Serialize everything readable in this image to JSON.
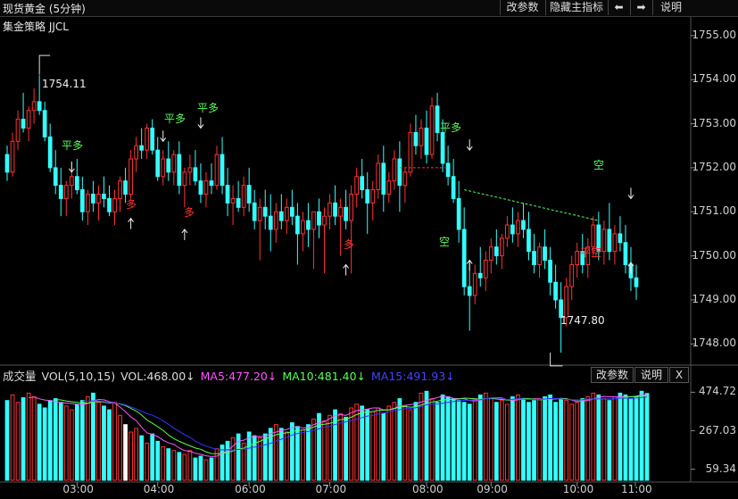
{
  "header": {
    "title": "现货黄金 (5分钟)",
    "btn_params": "改参数",
    "btn_hide": "隐藏主指标",
    "btn_left": "⬅",
    "btn_right": "➡",
    "btn_help": "说明"
  },
  "strategy_label": "集金策略 JJCL",
  "price_axis": [
    "1755.00",
    "1754.00",
    "1753.00",
    "1752.00",
    "1751.00",
    "1750.00",
    "1749.00",
    "1748.00"
  ],
  "annotations": {
    "high": "1754.11",
    "low": "1747.80"
  },
  "signals": {
    "flat_long": "平多",
    "long": "多",
    "short": "空",
    "flat_short": "平空"
  },
  "volume_legend": {
    "name": "成交量",
    "vol_params": "VOL(5,10,15)",
    "vol": "VOL:468.00↓",
    "ma5": "MA5:477.20↓",
    "ma10": "MA10:481.40↓",
    "ma15": "MA15:491.93↓",
    "btn_params": "改参数",
    "btn_help": "说明",
    "btn_close": "X"
  },
  "volume_axis": [
    "474.72",
    "267.03",
    "59.34"
  ],
  "time_axis": [
    "03:00",
    "04:00",
    "06:00",
    "07:00",
    "08:00",
    "09:00",
    "10:00",
    "11:00"
  ],
  "colors": {
    "up": "#ff3333",
    "down": "#33ffff",
    "ma5": "#ff55ff",
    "ma10": "#55ff55",
    "ma15": "#3333ff",
    "ma_white": "#ffffff"
  },
  "chart_data": {
    "type": "candlestick",
    "ylim": [
      1747.6,
      1755.2
    ],
    "candles": [
      [
        1752.3,
        1752.5,
        1751.7,
        1751.9
      ],
      [
        1751.9,
        1752.8,
        1751.8,
        1752.6
      ],
      [
        1752.6,
        1753.3,
        1752.4,
        1753.1
      ],
      [
        1753.1,
        1753.7,
        1752.8,
        1752.9
      ],
      [
        1752.9,
        1753.4,
        1752.6,
        1753.3
      ],
      [
        1753.3,
        1753.8,
        1753.0,
        1753.5
      ],
      [
        1753.5,
        1754.1,
        1753.2,
        1753.3
      ],
      [
        1753.3,
        1753.5,
        1752.6,
        1752.7
      ],
      [
        1752.7,
        1753.0,
        1751.9,
        1752.0
      ],
      [
        1752.0,
        1752.4,
        1751.4,
        1751.6
      ],
      [
        1751.6,
        1752.0,
        1750.9,
        1751.3
      ],
      [
        1751.3,
        1751.7,
        1750.9,
        1751.6
      ],
      [
        1751.6,
        1752.1,
        1751.3,
        1751.8
      ],
      [
        1751.8,
        1752.2,
        1751.4,
        1751.5
      ],
      [
        1751.5,
        1751.8,
        1750.8,
        1751.0
      ],
      [
        1751.0,
        1751.5,
        1750.7,
        1751.4
      ],
      [
        1751.4,
        1751.7,
        1751.0,
        1751.2
      ],
      [
        1751.2,
        1751.6,
        1750.8,
        1751.4
      ],
      [
        1751.4,
        1751.8,
        1751.1,
        1751.3
      ],
      [
        1751.3,
        1751.6,
        1750.9,
        1751.0
      ],
      [
        1751.0,
        1751.5,
        1750.7,
        1751.3
      ],
      [
        1751.3,
        1751.8,
        1751.0,
        1751.7
      ],
      [
        1751.7,
        1752.0,
        1751.2,
        1751.4
      ],
      [
        1751.4,
        1752.4,
        1751.3,
        1752.2
      ],
      [
        1752.2,
        1752.7,
        1751.9,
        1752.5
      ],
      [
        1752.5,
        1752.9,
        1752.2,
        1752.4
      ],
      [
        1752.4,
        1753.0,
        1752.2,
        1752.9
      ],
      [
        1752.9,
        1753.1,
        1752.3,
        1752.4
      ],
      [
        1752.4,
        1752.7,
        1751.7,
        1751.8
      ],
      [
        1751.8,
        1752.4,
        1751.6,
        1752.2
      ],
      [
        1752.2,
        1752.6,
        1751.7,
        1751.9
      ],
      [
        1751.9,
        1752.4,
        1751.6,
        1752.3
      ],
      [
        1752.3,
        1752.6,
        1751.4,
        1751.6
      ],
      [
        1751.6,
        1752.0,
        1751.1,
        1751.9
      ],
      [
        1751.9,
        1752.3,
        1751.6,
        1752.0
      ],
      [
        1752.0,
        1752.4,
        1751.6,
        1751.7
      ],
      [
        1751.7,
        1752.1,
        1751.2,
        1751.4
      ],
      [
        1751.4,
        1751.9,
        1751.1,
        1751.7
      ],
      [
        1751.7,
        1752.1,
        1751.4,
        1751.6
      ],
      [
        1751.6,
        1752.5,
        1751.5,
        1752.3
      ],
      [
        1752.3,
        1752.7,
        1751.4,
        1751.6
      ],
      [
        1751.6,
        1752.0,
        1750.9,
        1751.2
      ],
      [
        1751.2,
        1751.6,
        1750.7,
        1751.3
      ],
      [
        1751.3,
        1751.7,
        1751.0,
        1751.1
      ],
      [
        1751.1,
        1751.8,
        1750.9,
        1751.6
      ],
      [
        1751.6,
        1752.0,
        1751.0,
        1751.2
      ],
      [
        1751.2,
        1751.5,
        1750.6,
        1750.8
      ],
      [
        1750.8,
        1751.3,
        1749.9,
        1751.1
      ],
      [
        1751.1,
        1751.5,
        1750.6,
        1750.9
      ],
      [
        1750.9,
        1751.4,
        1750.1,
        1750.6
      ],
      [
        1750.6,
        1751.2,
        1750.3,
        1751.0
      ],
      [
        1751.0,
        1751.4,
        1750.6,
        1750.8
      ],
      [
        1750.8,
        1751.3,
        1750.5,
        1751.1
      ],
      [
        1751.1,
        1751.5,
        1750.7,
        1750.9
      ],
      [
        1750.9,
        1751.2,
        1749.8,
        1750.5
      ],
      [
        1750.5,
        1751.0,
        1750.1,
        1750.8
      ],
      [
        1750.8,
        1751.2,
        1750.2,
        1750.6
      ],
      [
        1750.6,
        1751.0,
        1749.7,
        1751.0
      ],
      [
        1751.0,
        1751.3,
        1750.4,
        1750.7
      ],
      [
        1750.7,
        1751.1,
        1749.6,
        1750.9
      ],
      [
        1750.9,
        1751.4,
        1750.6,
        1751.2
      ],
      [
        1751.2,
        1751.6,
        1750.7,
        1750.9
      ],
      [
        1750.9,
        1751.3,
        1750.0,
        1751.1
      ],
      [
        1751.1,
        1751.5,
        1750.6,
        1750.8
      ],
      [
        1750.8,
        1751.6,
        1749.6,
        1751.4
      ],
      [
        1751.4,
        1752.0,
        1751.1,
        1751.8
      ],
      [
        1751.8,
        1752.2,
        1751.3,
        1751.5
      ],
      [
        1751.5,
        1751.9,
        1750.5,
        1751.2
      ],
      [
        1751.2,
        1751.7,
        1750.8,
        1751.5
      ],
      [
        1751.5,
        1752.3,
        1751.3,
        1752.1
      ],
      [
        1752.1,
        1752.5,
        1751.0,
        1751.4
      ],
      [
        1751.4,
        1751.9,
        1751.2,
        1751.7
      ],
      [
        1751.7,
        1752.4,
        1751.5,
        1752.2
      ],
      [
        1752.2,
        1752.6,
        1751.0,
        1751.6
      ],
      [
        1751.6,
        1752.0,
        1751.2,
        1751.9
      ],
      [
        1751.9,
        1753.0,
        1751.8,
        1752.8
      ],
      [
        1752.8,
        1753.2,
        1752.3,
        1752.5
      ],
      [
        1752.5,
        1753.1,
        1752.2,
        1752.9
      ],
      [
        1752.9,
        1753.3,
        1752.1,
        1752.3
      ],
      [
        1752.3,
        1753.6,
        1752.2,
        1753.4
      ],
      [
        1753.4,
        1753.7,
        1752.6,
        1752.8
      ],
      [
        1752.8,
        1753.1,
        1751.9,
        1752.1
      ],
      [
        1752.1,
        1752.5,
        1751.6,
        1751.8
      ],
      [
        1751.8,
        1752.2,
        1751.2,
        1751.3
      ],
      [
        1751.3,
        1751.7,
        1750.3,
        1750.6
      ],
      [
        1750.6,
        1751.1,
        1749.1,
        1749.3
      ],
      [
        1749.3,
        1749.9,
        1748.3,
        1749.1
      ],
      [
        1749.1,
        1749.8,
        1748.9,
        1749.6
      ],
      [
        1749.6,
        1750.2,
        1749.3,
        1749.5
      ],
      [
        1749.5,
        1750.1,
        1749.2,
        1749.9
      ],
      [
        1749.9,
        1750.4,
        1749.6,
        1750.2
      ],
      [
        1750.2,
        1750.6,
        1749.8,
        1750.0
      ],
      [
        1750.0,
        1750.5,
        1749.7,
        1750.4
      ],
      [
        1750.4,
        1750.9,
        1750.2,
        1750.7
      ],
      [
        1750.7,
        1751.1,
        1750.3,
        1750.5
      ],
      [
        1750.5,
        1751.0,
        1750.2,
        1750.8
      ],
      [
        1750.8,
        1751.2,
        1750.4,
        1750.6
      ],
      [
        1750.6,
        1751.0,
        1749.9,
        1750.1
      ],
      [
        1750.1,
        1750.5,
        1749.6,
        1749.8
      ],
      [
        1749.8,
        1750.3,
        1749.5,
        1750.2
      ],
      [
        1750.2,
        1750.6,
        1749.7,
        1749.9
      ],
      [
        1749.9,
        1750.2,
        1749.1,
        1749.4
      ],
      [
        1749.4,
        1749.8,
        1748.8,
        1749.0
      ],
      [
        1749.0,
        1749.4,
        1747.8,
        1748.6
      ],
      [
        1748.6,
        1749.5,
        1748.4,
        1749.3
      ],
      [
        1749.3,
        1750.0,
        1749.0,
        1749.8
      ],
      [
        1749.8,
        1750.3,
        1749.5,
        1750.1
      ],
      [
        1750.1,
        1750.5,
        1749.6,
        1749.8
      ],
      [
        1749.8,
        1750.4,
        1749.5,
        1750.2
      ],
      [
        1750.2,
        1750.9,
        1750.0,
        1750.7
      ],
      [
        1750.7,
        1751.0,
        1749.9,
        1750.1
      ],
      [
        1750.1,
        1750.8,
        1749.8,
        1750.6
      ],
      [
        1750.6,
        1751.2,
        1749.9,
        1750.1
      ],
      [
        1750.1,
        1750.7,
        1749.8,
        1750.5
      ],
      [
        1750.5,
        1750.9,
        1750.1,
        1750.3
      ],
      [
        1750.3,
        1750.7,
        1749.6,
        1749.8
      ],
      [
        1749.8,
        1750.2,
        1749.2,
        1749.5
      ],
      [
        1749.5,
        1749.8,
        1749.0,
        1749.3
      ]
    ],
    "volume": [
      430,
      460,
      420,
      445,
      470,
      450,
      410,
      390,
      430,
      440,
      420,
      400,
      380,
      410,
      430,
      450,
      470,
      420,
      400,
      380,
      420,
      350,
      300,
      260,
      280,
      240,
      200,
      250,
      210,
      180,
      170,
      160,
      150,
      140,
      160,
      120,
      130,
      110,
      120,
      170,
      190,
      210,
      230,
      250,
      200,
      260,
      240,
      230,
      250,
      280,
      300,
      280,
      260,
      310,
      290,
      270,
      300,
      330,
      360,
      320,
      350,
      380,
      360,
      340,
      390,
      410,
      400,
      380,
      370,
      390,
      360,
      400,
      420,
      440,
      400,
      380,
      420,
      470,
      480,
      440,
      420,
      460,
      450,
      440,
      430,
      420,
      410,
      440,
      460,
      470,
      440,
      420,
      430,
      410,
      450,
      460,
      440,
      420,
      430,
      440,
      450,
      460,
      420,
      440,
      430,
      410,
      420,
      440,
      450,
      470,
      460,
      440,
      430,
      450,
      470,
      460,
      440,
      450,
      480,
      468
    ]
  }
}
